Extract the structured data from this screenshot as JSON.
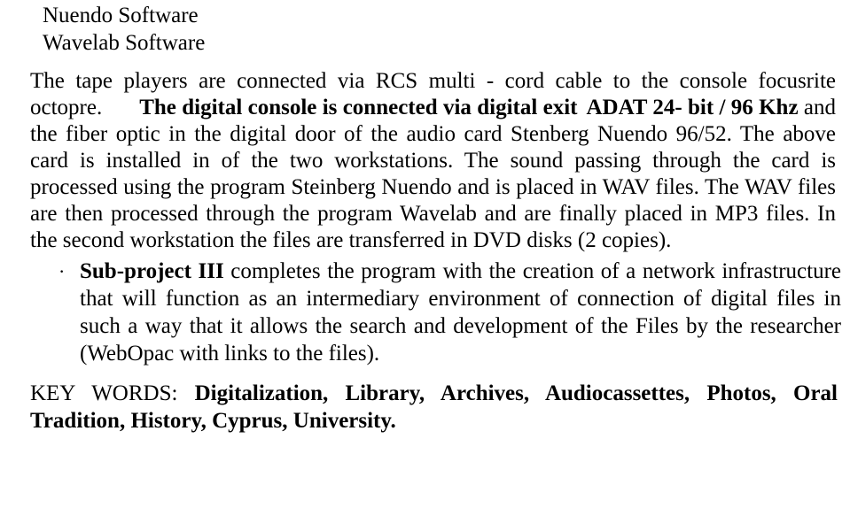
{
  "document": {
    "heading_lines": [
      "Nuendo Software",
      "Wavelab Software"
    ],
    "paragraph_1": {
      "line_1": "The tape players are connected via RCS multi - cord cable to the console focusrite",
      "line_2_start": "octopre.",
      "line_2_rest": "The digital console is connected via digital exit",
      "line_2_tail": "ADAT  24- bit / 96  Khz",
      "line_3": "and the fiber optic in the digital door of the audio card Stenberg Nuendo  96/52. The",
      "line_4": "above card is installed in of the two workstations. The sound passing through the card",
      "line_5": "is processed using the program Steinberg Nuendo and is placed in WAV files.  The",
      "line_6": "WAV files are then processed through the program Wavelab and are finally placed in",
      "line_7": "MP3 files.",
      "line_8": "In the second workstation the files are transferred in DVD disks (2 copies)."
    },
    "bullet_item": {
      "marker": "·",
      "bold_lead": "Sub-project  III",
      "text": "completes  the  program  with  the  creation  of  a  network infrastructure that will function as an intermediary environment of connection of digital files in such a way that it allows the search and development of the Files by the researcher (WebOpac with links to the files)."
    },
    "keywords": {
      "label": "KEY WORDS: ",
      "body": "Digitalization, Library, Archives, Audiocassettes, Photos, Oral Tradition, History, Cyprus, University."
    }
  }
}
